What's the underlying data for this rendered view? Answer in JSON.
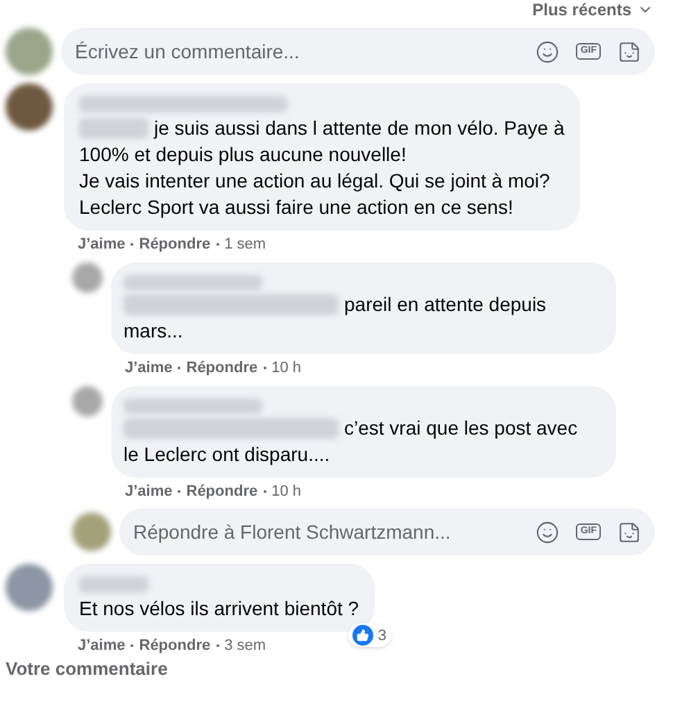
{
  "sort": {
    "label": "Plus récents"
  },
  "composer": {
    "placeholder": "Écrivez un commentaire...",
    "gif_label": "GIF"
  },
  "comments": [
    {
      "mention": true,
      "lines": [
        "je suis aussi dans l attente de mon vélo. Paye à",
        "100% et depuis plus aucune nouvelle!",
        "Je vais intenter une action au légal. Qui se joint à moi?",
        "Leclerc Sport va aussi faire une action en ce sens!"
      ],
      "like": "J’aime",
      "reply": "Répondre",
      "time": "1 sem",
      "replies": [
        {
          "lines": [
            "pareil en attente depuis",
            "mars..."
          ],
          "like": "J’aime",
          "reply": "Répondre",
          "time": "10 h"
        },
        {
          "lines": [
            "c’est vrai que les post avec",
            "le Leclerc ont disparu...."
          ],
          "like": "J’aime",
          "reply": "Répondre",
          "time": "10 h"
        }
      ],
      "reply_box": {
        "placeholder": "Répondre à Florent Schwartzmann...",
        "gif_label": "GIF"
      }
    },
    {
      "mention": false,
      "lines": [
        "Et nos vélos ils arrivent bientôt ?"
      ],
      "like": "J’aime",
      "reply": "Répondre",
      "time": "3 sem",
      "reactions": "3"
    }
  ],
  "footer": {
    "label": "Votre commentaire"
  }
}
